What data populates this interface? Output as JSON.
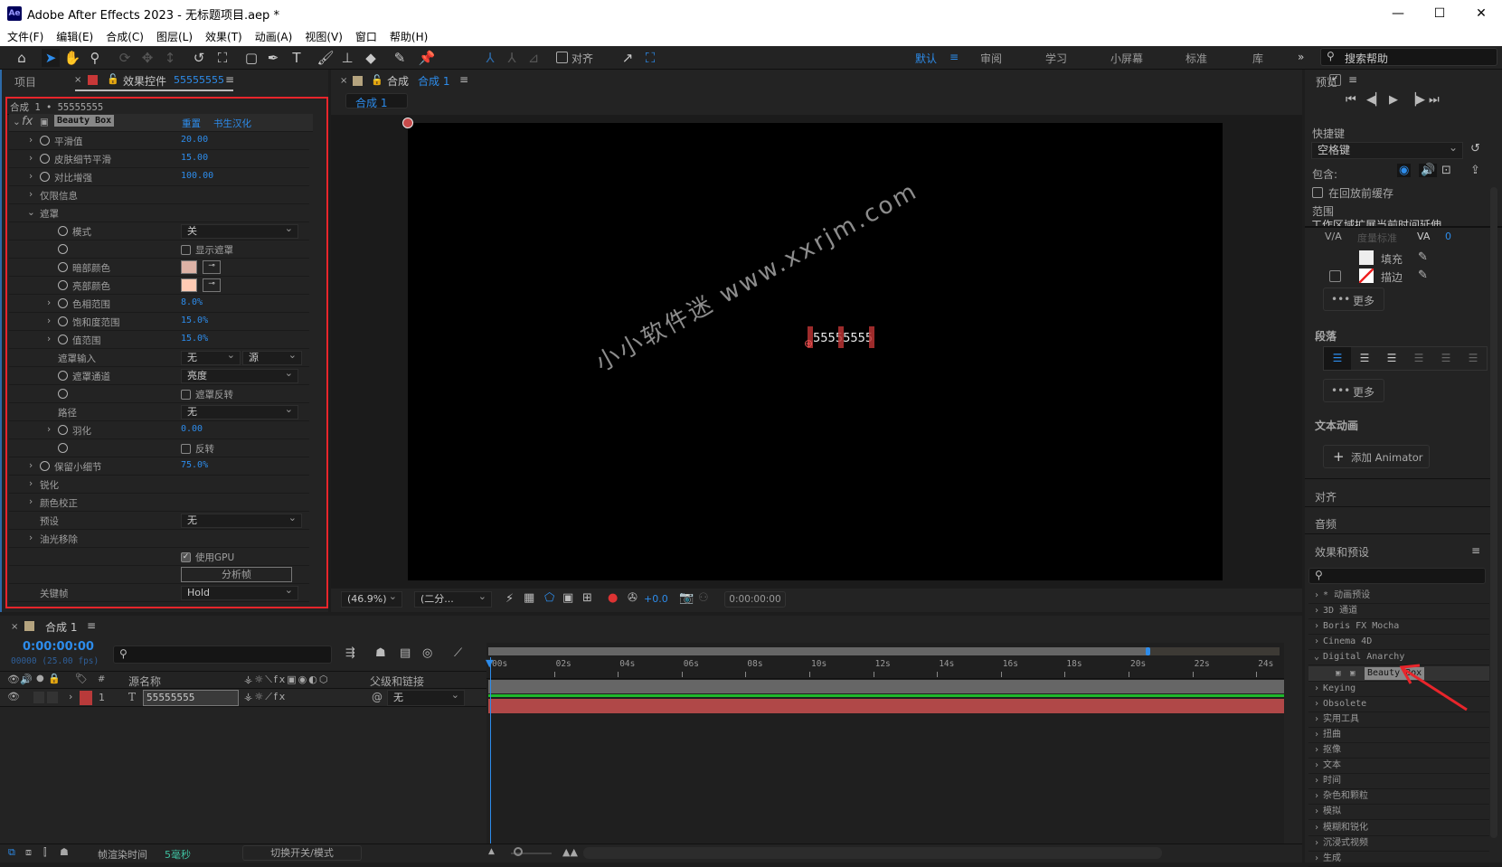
{
  "app": {
    "title": "Adobe After Effects 2023 - 无标题项目.aep *",
    "logo": "Ae"
  },
  "menu": [
    "文件(F)",
    "编辑(E)",
    "合成(C)",
    "图层(L)",
    "效果(T)",
    "动画(A)",
    "视图(V)",
    "窗口",
    "帮助(H)"
  ],
  "toolbar": {
    "align_label": "对齐",
    "workspaces": [
      "默认",
      "审阅",
      "学习",
      "小屏幕",
      "标准",
      "库"
    ],
    "active_workspace": "默认",
    "search_placeholder": "搜索帮助"
  },
  "left_panel": {
    "tabs": [
      "项目",
      "效果控件"
    ],
    "layer_name": "55555555",
    "breadcrumb": "合成 1 • 55555555",
    "effect": {
      "name": "Beauty Box",
      "reset": "重置",
      "about": "书生汉化"
    },
    "rows": [
      {
        "lvl": 1,
        "tw": ">",
        "sw": true,
        "label": "平滑值",
        "num": "20.00"
      },
      {
        "lvl": 1,
        "tw": ">",
        "sw": true,
        "label": "皮肤细节平滑",
        "num": "15.00"
      },
      {
        "lvl": 1,
        "tw": ">",
        "sw": true,
        "label": "对比增强",
        "num": "100.00"
      },
      {
        "lvl": 1,
        "tw": ">",
        "sw": false,
        "label": "仅限信息"
      },
      {
        "lvl": 1,
        "tw": "v",
        "sw": false,
        "label": "遮罩"
      },
      {
        "lvl": 2,
        "tw": "",
        "sw": true,
        "label": "模式",
        "dd": "关"
      },
      {
        "lvl": 2,
        "tw": "",
        "sw": true,
        "label": "",
        "cb": "显示遮罩",
        "checked": false
      },
      {
        "lvl": 2,
        "tw": "",
        "sw": true,
        "label": "暗部颜色",
        "color": "#dcb2a6"
      },
      {
        "lvl": 2,
        "tw": "",
        "sw": true,
        "label": "亮部颜色",
        "color": "#ffcbb4"
      },
      {
        "lvl": 2,
        "tw": ">",
        "sw": true,
        "label": "色相范围",
        "num": "8.0%"
      },
      {
        "lvl": 2,
        "tw": ">",
        "sw": true,
        "label": "饱和度范围",
        "num": "15.0%"
      },
      {
        "lvl": 2,
        "tw": ">",
        "sw": true,
        "label": "值范围",
        "num": "15.0%"
      },
      {
        "lvl": 2,
        "tw": "",
        "sw": false,
        "label": "遮罩输入",
        "dd": "无",
        "dd2": "源"
      },
      {
        "lvl": 2,
        "tw": "",
        "sw": true,
        "label": "遮罩通道",
        "dd": "亮度"
      },
      {
        "lvl": 2,
        "tw": "",
        "sw": true,
        "label": "",
        "cb": "遮罩反转",
        "checked": false
      },
      {
        "lvl": 2,
        "tw": "",
        "sw": false,
        "label": "路径",
        "dd": "无"
      },
      {
        "lvl": 2,
        "tw": ">",
        "sw": true,
        "label": "羽化",
        "num": "0.00"
      },
      {
        "lvl": 2,
        "tw": "",
        "sw": true,
        "label": "",
        "cb": "反转",
        "checked": false
      },
      {
        "lvl": 1,
        "tw": ">",
        "sw": true,
        "label": "保留小细节",
        "num": "75.0%"
      },
      {
        "lvl": 1,
        "tw": ">",
        "sw": false,
        "label": "锐化"
      },
      {
        "lvl": 1,
        "tw": ">",
        "sw": false,
        "label": "颜色校正"
      },
      {
        "lvl": 1,
        "tw": "",
        "sw": false,
        "label": "预设",
        "ddw": "无"
      },
      {
        "lvl": 1,
        "tw": ">",
        "sw": false,
        "label": "油光移除"
      },
      {
        "lvl": 1,
        "tw": "",
        "sw": false,
        "label": "",
        "cb": "使用GPU",
        "checked": true
      },
      {
        "lvl": 1,
        "tw": "",
        "sw": false,
        "label": "",
        "btn": "分析帧"
      },
      {
        "lvl": 1,
        "tw": "",
        "sw": false,
        "label": "关键帧",
        "dd": "Hold"
      }
    ]
  },
  "viewer": {
    "tab_prefix": "合成",
    "tab_comp": "合成 1",
    "subtab": "合成 1",
    "text_layer": "55555555",
    "watermark": "小小软件迷 www.xxrjm.com",
    "zoom": "(46.9%)",
    "resolution": "(二分...",
    "exposure": "+0.0",
    "timecode": "0:00:00:00"
  },
  "timeline": {
    "tab": "合成 1",
    "timecode": "0:00:00:00",
    "frames": "00000 (25.00 fps)",
    "cols": {
      "hash": "#",
      "source": "源名称",
      "parent": "父级和链接"
    },
    "ruler": [
      "00s",
      "02s",
      "04s",
      "06s",
      "08s",
      "10s",
      "12s",
      "14s",
      "16s",
      "18s",
      "20s",
      "22s",
      "24s"
    ],
    "layer": {
      "num": "1",
      "type": "T",
      "name": "55555555",
      "parent": "无",
      "color": "#b83a3a"
    },
    "status": {
      "render_label": "帧渲染时间",
      "render_value": "5毫秒",
      "toggle": "切换开关/模式"
    }
  },
  "right_panel": {
    "preview": "预览",
    "shortcut_label": "快捷键",
    "shortcut": "空格键",
    "include": "包含:",
    "cache": "在回放前缓存",
    "range": "范围",
    "range_value": "工作区域扩展当前时间延伸",
    "metrics": "度量标准",
    "tracking": "0",
    "fill": "填充",
    "stroke": "描边",
    "more": "更多",
    "paragraph": "段落",
    "text_anim": "文本动画",
    "add_animator": "添加 Animator",
    "align": "对齐",
    "audio": "音频",
    "effects": "效果和预设",
    "fx_list": [
      "* 动画预设",
      "3D 通道",
      "Boris FX Mocha",
      "Cinema 4D",
      "Digital Anarchy",
      "Beauty Box",
      "Keying",
      "Obsolete",
      "实用工具",
      "扭曲",
      "抠像",
      "文本",
      "时间",
      "杂色和颗粒",
      "模拟",
      "模糊和锐化",
      "沉浸式视频",
      "生成"
    ],
    "expanded": "Digital Anarchy",
    "selected": "Beauty Box"
  },
  "colors": {
    "accent": "#2d8ceb",
    "highlight": "#e8252b",
    "layer_bar": "#b04848",
    "work_area": "#1fb82b"
  }
}
